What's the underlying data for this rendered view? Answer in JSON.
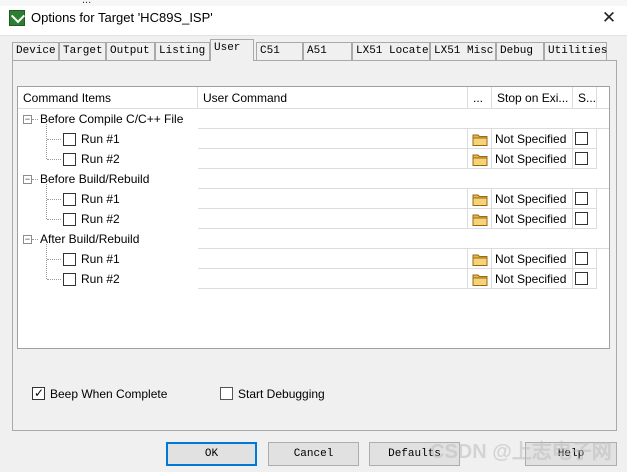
{
  "window": {
    "title": "Options for Target 'HC89S_ISP'",
    "behind_text": "...          "
  },
  "tabs": [
    {
      "label": "Device"
    },
    {
      "label": "Target"
    },
    {
      "label": "Output"
    },
    {
      "label": "Listing"
    },
    {
      "label": "User",
      "active": true
    },
    {
      "label": "C51"
    },
    {
      "label": "A51"
    },
    {
      "label": "LX51 Locate"
    },
    {
      "label": "LX51 Misc"
    },
    {
      "label": "Debug"
    },
    {
      "label": "Utilities"
    }
  ],
  "grid": {
    "headers": {
      "command_items": "Command Items",
      "user_command": "User Command",
      "browse": "...",
      "stop_on_exit": "Stop on Exi...",
      "s": "S..."
    },
    "groups": [
      {
        "label": "Before Compile C/C++ File",
        "runs": [
          {
            "label": "Run #1",
            "checked": false,
            "command": "",
            "stop": "Not Specified",
            "s": false
          },
          {
            "label": "Run #2",
            "checked": false,
            "command": "",
            "stop": "Not Specified",
            "s": false
          }
        ]
      },
      {
        "label": "Before Build/Rebuild",
        "runs": [
          {
            "label": "Run #1",
            "checked": false,
            "command": "",
            "stop": "Not Specified",
            "s": false
          },
          {
            "label": "Run #2",
            "checked": false,
            "command": "",
            "stop": "Not Specified",
            "s": false
          }
        ]
      },
      {
        "label": "After Build/Rebuild",
        "runs": [
          {
            "label": "Run #1",
            "checked": false,
            "command": "",
            "stop": "Not Specified",
            "s": false
          },
          {
            "label": "Run #2",
            "checked": false,
            "command": "",
            "stop": "Not Specified",
            "s": false
          }
        ]
      }
    ]
  },
  "options": {
    "beep_label": "Beep When Complete",
    "beep_checked": true,
    "start_debug_label": "Start Debugging",
    "start_debug_checked": false
  },
  "buttons": {
    "ok": "OK",
    "cancel": "Cancel",
    "defaults": "Defaults",
    "help": "Help"
  },
  "watermark": "CSDN @上志电子网"
}
